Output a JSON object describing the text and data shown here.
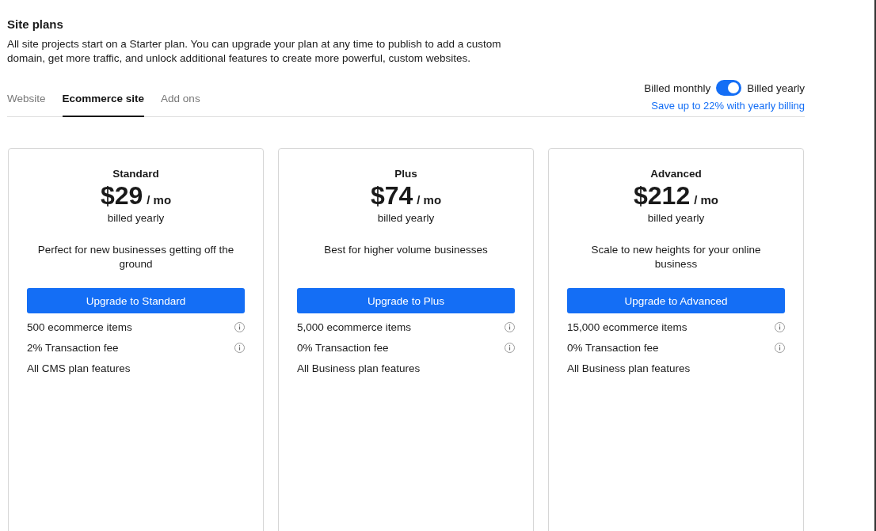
{
  "header": {
    "title": "Site plans",
    "description": "All site projects start on a Starter plan. You can upgrade your plan at any time to publish to add a custom domain, get more traffic, and unlock additional features to create more powerful, custom websites."
  },
  "tabs": [
    {
      "label": "Website",
      "selected": false
    },
    {
      "label": "Ecommerce site",
      "selected": true
    },
    {
      "label": "Add ons",
      "selected": false
    }
  ],
  "billing": {
    "left_label": "Billed monthly",
    "right_label": "Billed yearly",
    "on": true,
    "savings_link": "Save up to 22% with yearly billing"
  },
  "plans": [
    {
      "name": "Standard",
      "price": "$29",
      "unit": "/ mo",
      "period": "billed yearly",
      "description": "Perfect for new businesses getting off the ground",
      "button": "Upgrade to Standard",
      "features": [
        {
          "text": "500 ecommerce items",
          "info": true
        },
        {
          "text": "2% Transaction fee",
          "info": true
        },
        {
          "text": "All CMS plan features",
          "info": false
        }
      ]
    },
    {
      "name": "Plus",
      "price": "$74",
      "unit": "/ mo",
      "period": "billed yearly",
      "description": "Best for higher volume businesses",
      "button": "Upgrade to Plus",
      "features": [
        {
          "text": "5,000 ecommerce items",
          "info": true
        },
        {
          "text": "0% Transaction fee",
          "info": true
        },
        {
          "text": "All Business plan features",
          "info": false
        }
      ]
    },
    {
      "name": "Advanced",
      "price": "$212",
      "unit": "/ mo",
      "period": "billed yearly",
      "description": "Scale to new heights for your online business",
      "button": "Upgrade to Advanced",
      "features": [
        {
          "text": "15,000 ecommerce items",
          "info": true
        },
        {
          "text": "0% Transaction fee",
          "info": true
        },
        {
          "text": "All Business plan features",
          "info": false
        }
      ]
    }
  ]
}
